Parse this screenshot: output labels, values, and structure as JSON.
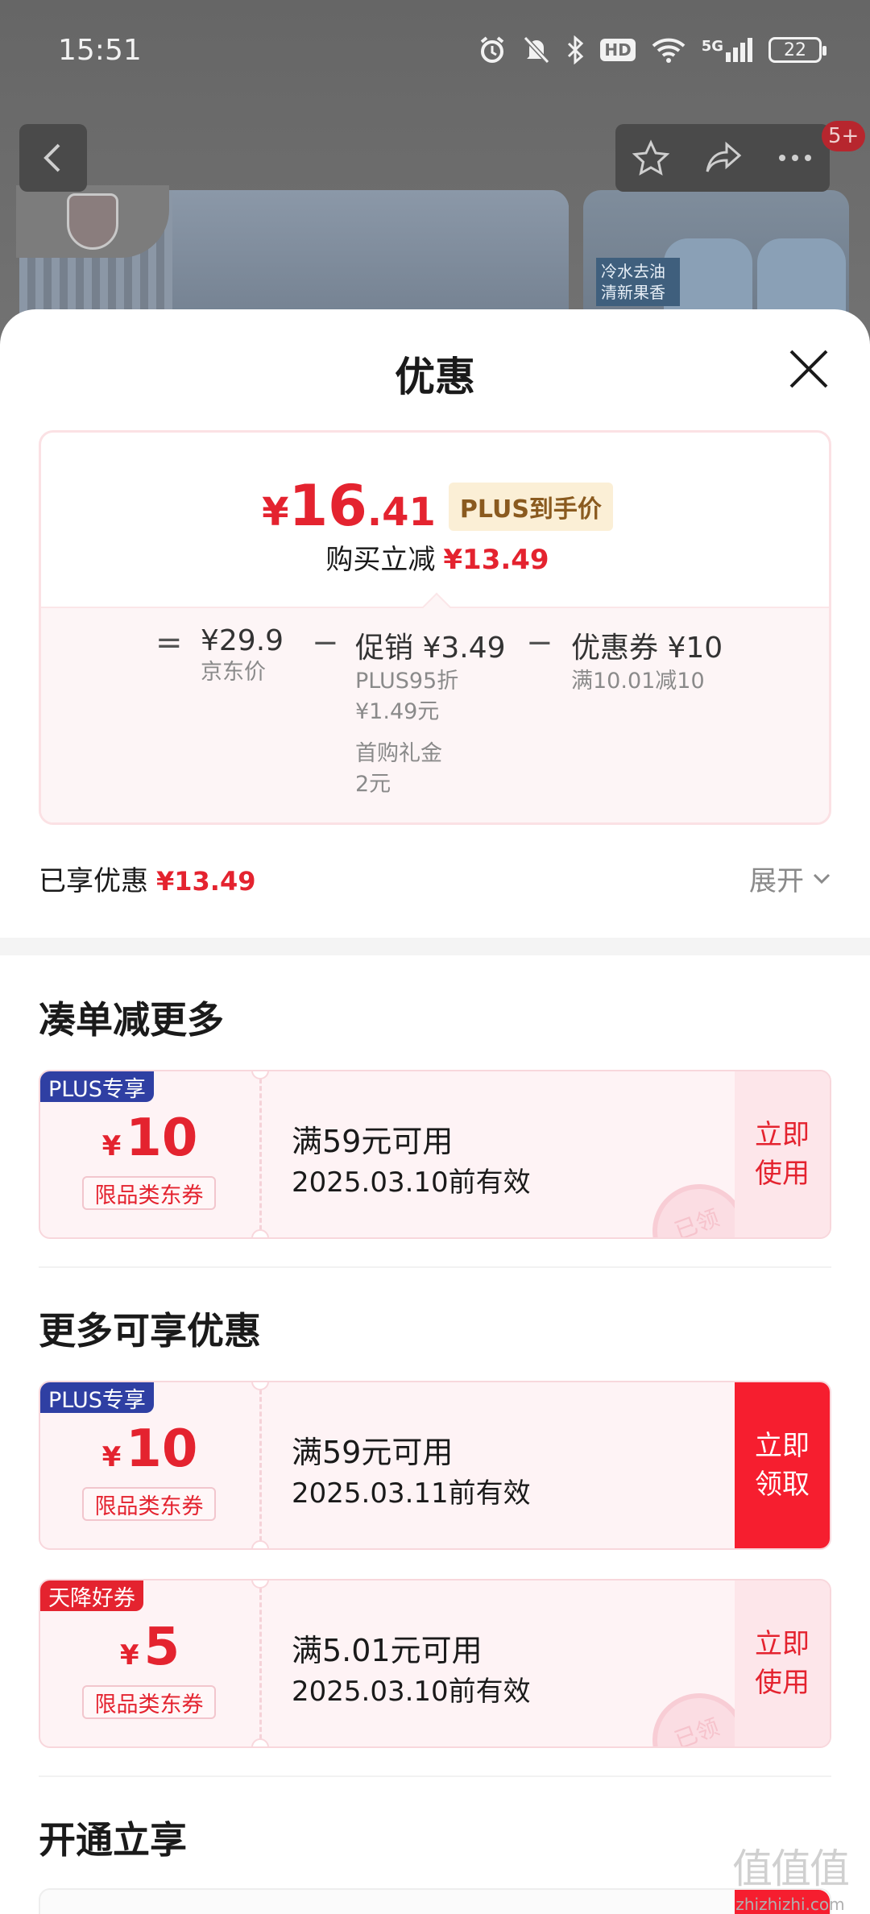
{
  "status_bar": {
    "time": "15:51",
    "network": "5G",
    "battery": "22",
    "hd": "HD"
  },
  "header": {
    "badge": "5+",
    "icons": [
      "back-icon",
      "star-icon",
      "share-icon",
      "more-icon"
    ]
  },
  "banner": {
    "right_text": "冷水去油\n清新果香"
  },
  "sheet": {
    "title": "优惠",
    "price_card": {
      "currency": "¥",
      "final_int": "16",
      "final_dec": ".41",
      "plus_tag": "PLUS到手价",
      "save_label": "购买立减",
      "save_value": "¥13.49",
      "breakdown": {
        "op_eq": "=",
        "op_minus": "−",
        "jd_price": "¥29.9",
        "jd_price_label": "京东价",
        "promo_label": "促销 ¥3.49",
        "promo_detail_1": "PLUS95折",
        "promo_detail_2": "¥1.49元",
        "promo_detail_3": "首购礼金",
        "promo_detail_4": "2元",
        "coupon_label": "优惠券 ¥10",
        "coupon_detail": "满10.01减10"
      }
    },
    "enjoyed": {
      "label": "已享优惠",
      "value": "¥13.49",
      "expand": "展开"
    },
    "sections": {
      "more_order": "凑单减更多",
      "more_benefits": "更多可享优惠",
      "open_enjoy": "开通立享"
    },
    "coupons": [
      {
        "tag": "PLUS专享",
        "currency": "¥",
        "amount": "10",
        "type": "限品类东券",
        "condition": "满59元可用",
        "validity": "2025.03.10前有效",
        "action": "立即\n使用",
        "stamp": "已领"
      },
      {
        "tag": "PLUS专享",
        "currency": "¥",
        "amount": "10",
        "type": "限品类东券",
        "condition": "满59元可用",
        "validity": "2025.03.11前有效",
        "action": "立即\n领取"
      },
      {
        "tag": "天降好券",
        "currency": "¥",
        "amount": "5",
        "type": "限品类东券",
        "condition": "满5.01元可用",
        "validity": "2025.03.10前有效",
        "action": "立即\n使用",
        "stamp": "已领"
      }
    ]
  },
  "watermark": {
    "logo": "值值值",
    "url": "zhizhizhi.com"
  },
  "colors": {
    "accent_red": "#e4232f",
    "plus_blue": "#2f3fa3",
    "plus_gold_bg": "#fbefd6"
  }
}
